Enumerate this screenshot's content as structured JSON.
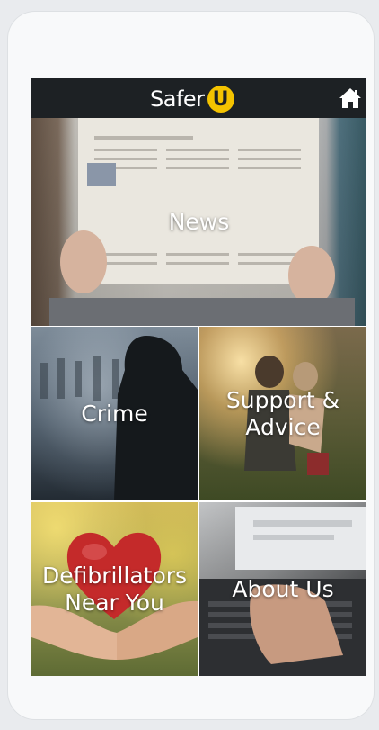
{
  "header": {
    "logo_text": "Safer",
    "logo_badge": "U",
    "home_icon": "home-icon"
  },
  "tiles": {
    "news": "News",
    "crime": "Crime",
    "support": "Support &\nAdvice",
    "defibrillators": "Defibrillators\nNear You",
    "about": "About Us"
  },
  "colors": {
    "header_bg": "#1d2124",
    "logo_accent": "#f4c300"
  }
}
